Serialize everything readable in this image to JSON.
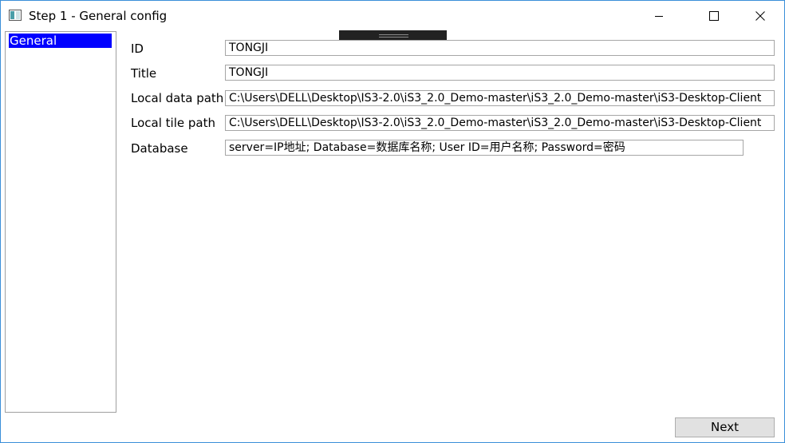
{
  "window": {
    "title": "Step 1 - General config",
    "icons": {
      "app": "window-app-icon",
      "minimize": "minimize-icon",
      "maximize": "maximize-icon",
      "close": "close-icon"
    }
  },
  "sidebar": {
    "items": [
      {
        "label": "General",
        "selected": true
      }
    ],
    "selected_color": "#0000ff"
  },
  "form": {
    "id": {
      "label": "ID",
      "value": "TONGJI"
    },
    "title": {
      "label": "Title",
      "value": "TONGJI"
    },
    "local_data_path": {
      "label": "Local data path",
      "value": "C:\\Users\\DELL\\Desktop\\IS3-2.0\\iS3_2.0_Demo-master\\iS3_2.0_Demo-master\\iS3-Desktop-Client"
    },
    "local_tile_path": {
      "label": "Local tile path",
      "value": "C:\\Users\\DELL\\Desktop\\IS3-2.0\\iS3_2.0_Demo-master\\iS3_2.0_Demo-master\\iS3-Desktop-Client"
    },
    "database": {
      "label": "Database",
      "value": "server=IP地址; Database=数据库名称; User ID=用户名称; Password=密码"
    }
  },
  "footer": {
    "next_label": "Next"
  }
}
